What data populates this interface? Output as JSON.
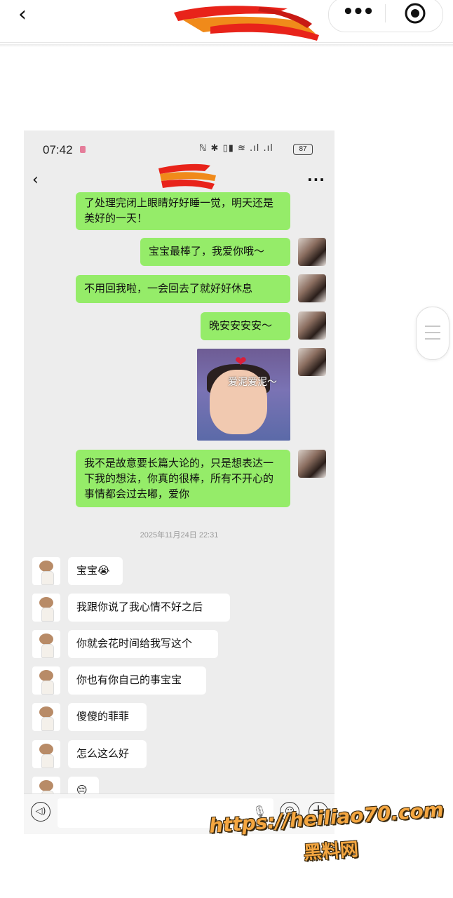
{
  "browser": {
    "back_icon": "chevron-left-icon",
    "more_icon": "more-dots-icon",
    "target_icon": "target-icon",
    "more_label": "•••",
    "back_label": "‹"
  },
  "phone": {
    "status": {
      "time": "07:42",
      "icons_label": "ℕ ✱ ▯▮ ≋ .ıl .ıl",
      "battery": "87"
    },
    "header": {
      "back_label": "‹",
      "menu_label": "···"
    },
    "messages": [
      {
        "side": "right",
        "text": "了处理完闭上眼睛好好睡一觉，明天还是美好的一天！"
      },
      {
        "side": "right",
        "text": "宝宝最棒了，我爱你哦～"
      },
      {
        "side": "right",
        "text": "不用回我啦，一会回去了就好好休息"
      },
      {
        "side": "right",
        "text": "晚安安安安～"
      },
      {
        "side": "right",
        "type": "sticker",
        "caption": "爱泥爱泥～"
      },
      {
        "side": "right",
        "text": "我不是故意要长篇大论的，只是想表达一下我的想法，你真的很棒，所有不开心的事情都会过去嘟，爱你"
      },
      {
        "type": "timestamp",
        "text": "2025年11月24日 22:31"
      },
      {
        "side": "left",
        "text": "宝宝😭"
      },
      {
        "side": "left",
        "text": "我跟你说了我心情不好之后"
      },
      {
        "side": "left",
        "text": "你就会花时间给我写这个"
      },
      {
        "side": "left",
        "text": "你也有你自己的事宝宝"
      },
      {
        "side": "left",
        "text": "傻傻的菲菲"
      },
      {
        "side": "left",
        "text": "怎么这么好"
      },
      {
        "side": "left",
        "text": "😔"
      }
    ],
    "input": {
      "voice_label": "◁)",
      "emoji_label": "☺",
      "plus_label": "+",
      "mic_label": "🎙"
    }
  },
  "watermark": {
    "url": "https://heiliao70.com",
    "name": "黑料网"
  },
  "colors": {
    "outgoing_bubble": "#95ec69",
    "incoming_bubble": "#ffffff",
    "chat_background": "#ededed"
  }
}
